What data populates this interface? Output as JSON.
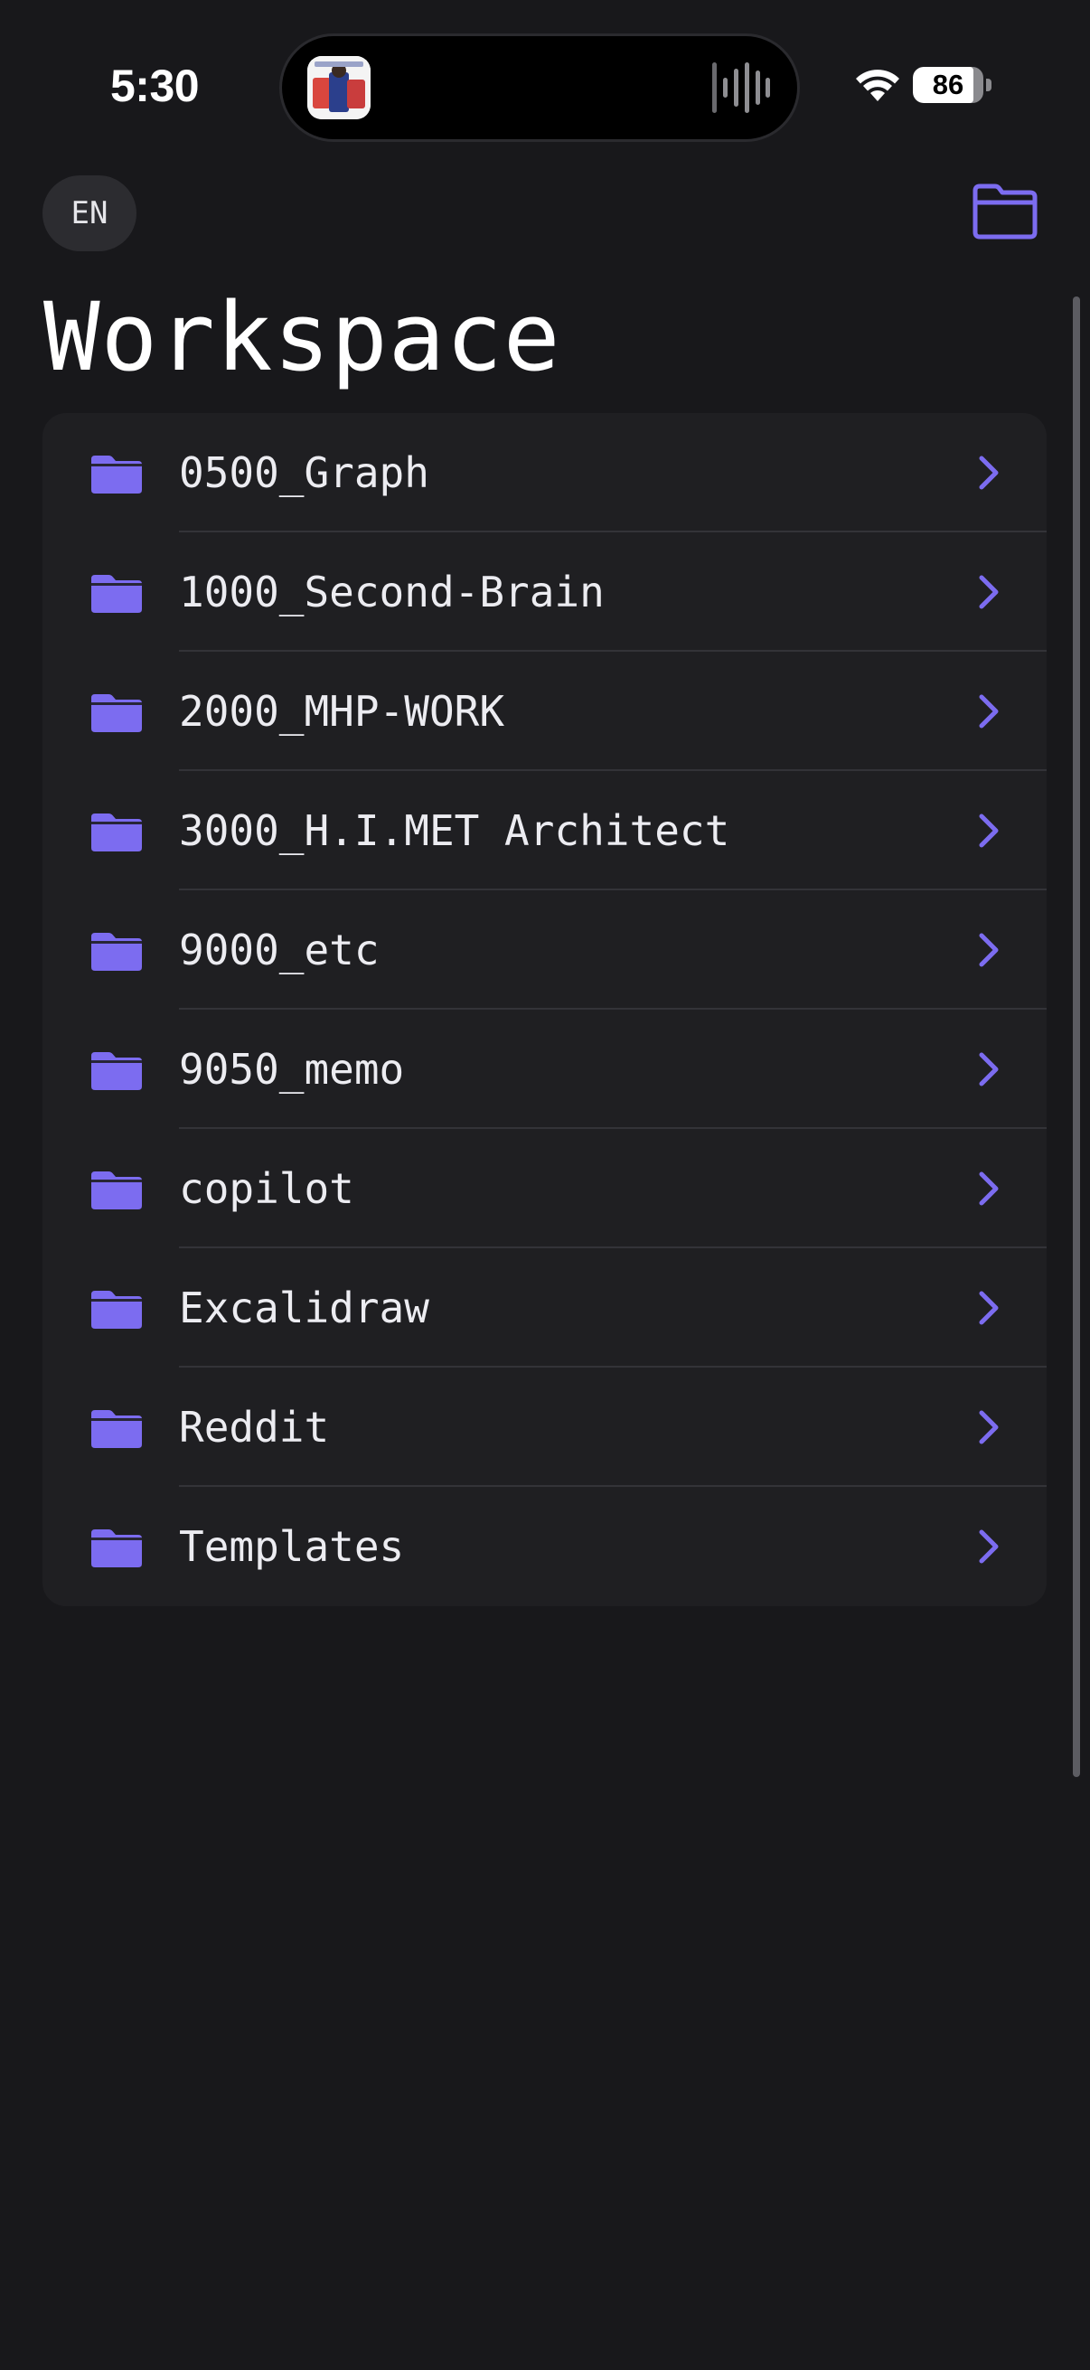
{
  "status_bar": {
    "time": "5:30",
    "battery_percent": 86,
    "battery_label": "86",
    "wifi_icon": "wifi-icon",
    "island_icons": [
      "app-thumbnail-icon",
      "audio-waveform-icon"
    ]
  },
  "header": {
    "language_label": "EN",
    "folder_picker_icon": "folder-outline-icon",
    "title": "Workspace"
  },
  "folders": [
    {
      "name": "0500_Graph"
    },
    {
      "name": "1000_Second-Brain"
    },
    {
      "name": "2000_MHP-WORK"
    },
    {
      "name": "3000_H.I.MET Architect"
    },
    {
      "name": "9000_etc"
    },
    {
      "name": "9050_memo"
    },
    {
      "name": "copilot"
    },
    {
      "name": "Excalidraw"
    },
    {
      "name": "Reddit"
    },
    {
      "name": "Templates"
    }
  ],
  "row_icons": {
    "leading": "folder-fill-icon",
    "trailing": "chevron-right-icon"
  },
  "colors": {
    "background": "#18181b",
    "card": "#1f1f22",
    "accent": "#7c6cf0",
    "text": "#ececf1",
    "divider": "#333338"
  }
}
